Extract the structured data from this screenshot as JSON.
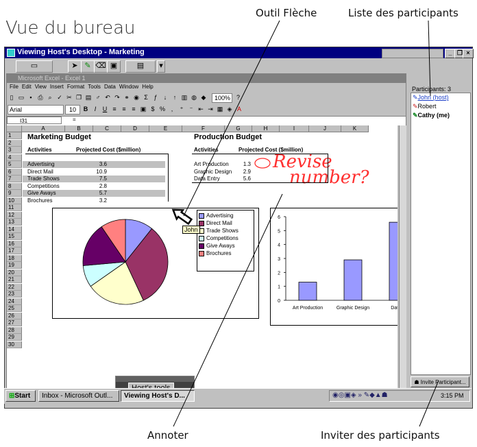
{
  "page_title": "Vue du bureau",
  "callouts": {
    "arrow_tool": "Outil Flèche",
    "participant_list": "Liste des participants",
    "annotate": "Annoter",
    "invite": "Inviter des participants"
  },
  "window": {
    "title": "Viewing Host's Desktop - Marketing",
    "btn_min": "_",
    "btn_max": "❐",
    "btn_close": "×"
  },
  "excel": {
    "title": "Microsoft Excel - Excel 1",
    "menu": [
      "File",
      "Edit",
      "View",
      "Insert",
      "Format",
      "Tools",
      "Data",
      "Window",
      "Help"
    ],
    "font_name": "Arial",
    "font_size": "10",
    "zoom": "100%",
    "name_box": "I31",
    "formula_eq": "=",
    "columns": [
      "A",
      "B",
      "C",
      "D",
      "E",
      "F",
      "G",
      "H",
      "I",
      "J",
      "K"
    ],
    "rows": [
      "1",
      "2",
      "3",
      "4",
      "5",
      "6",
      "7",
      "8",
      "9",
      "10",
      "11",
      "12",
      "13",
      "14",
      "15",
      "16",
      "17",
      "18",
      "19",
      "20",
      "21",
      "22",
      "23",
      "24",
      "25",
      "26",
      "27",
      "28",
      "29",
      "30"
    ],
    "marketing": {
      "title": "Marketing Budget",
      "col1": "Activities",
      "col2": "Projected Cost ($million)",
      "rows": [
        {
          "label": "Advertising",
          "value": "3.6"
        },
        {
          "label": "Direct Mail",
          "value": "10.9"
        },
        {
          "label": "Trade Shows",
          "value": "7.5"
        },
        {
          "label": "Competitions",
          "value": "2.8"
        },
        {
          "label": "Give Aways",
          "value": "5.7"
        },
        {
          "label": "Brochures",
          "value": "3.2"
        }
      ]
    },
    "production": {
      "title": "Production Budget",
      "col1": "Activities",
      "col2": "Projected Cost ($million)",
      "rows": [
        {
          "label": "Art Production",
          "value": "1.3"
        },
        {
          "label": "Graphic Design",
          "value": "2.9"
        },
        {
          "label": "Data Entry",
          "value": "5.6"
        }
      ]
    },
    "annotation": {
      "line1": "Revise",
      "line2": "number?"
    },
    "pointer_label": "John",
    "hosts_tools": "Host's tools"
  },
  "panel": {
    "count_label": "Participants: 3",
    "participants": [
      {
        "name": "John (host)",
        "color": "#1a3dc8"
      },
      {
        "name": "Robert",
        "color": "#c81a1a"
      },
      {
        "name": "Cathy (me)",
        "color": "#1a8a2a"
      }
    ],
    "invite_button": "Invite Participant..."
  },
  "taskbar": {
    "start": "Start",
    "tasks": [
      "Inbox - Microsoft Outl...",
      "Viewing Host's D..."
    ],
    "clock": "3:15 PM"
  },
  "chart_data": [
    {
      "type": "pie",
      "categories": [
        "Advertising",
        "Direct Mail",
        "Trade Shows",
        "Competitions",
        "Give Aways",
        "Brochures"
      ],
      "values": [
        3.6,
        10.9,
        7.5,
        2.8,
        5.7,
        3.2
      ],
      "colors": [
        "#9999ff",
        "#993366",
        "#ffffcc",
        "#ccffff",
        "#660066",
        "#ff8080"
      ],
      "legend": "right"
    },
    {
      "type": "bar",
      "categories": [
        "Art Production",
        "Graphic Design",
        "Data E"
      ],
      "values": [
        1.3,
        2.9,
        5.6
      ],
      "ylim": [
        0,
        6
      ],
      "yticks": [
        "0",
        "1",
        "2",
        "3",
        "4",
        "5",
        "6"
      ],
      "color": "#9999ff",
      "grid": false
    }
  ]
}
